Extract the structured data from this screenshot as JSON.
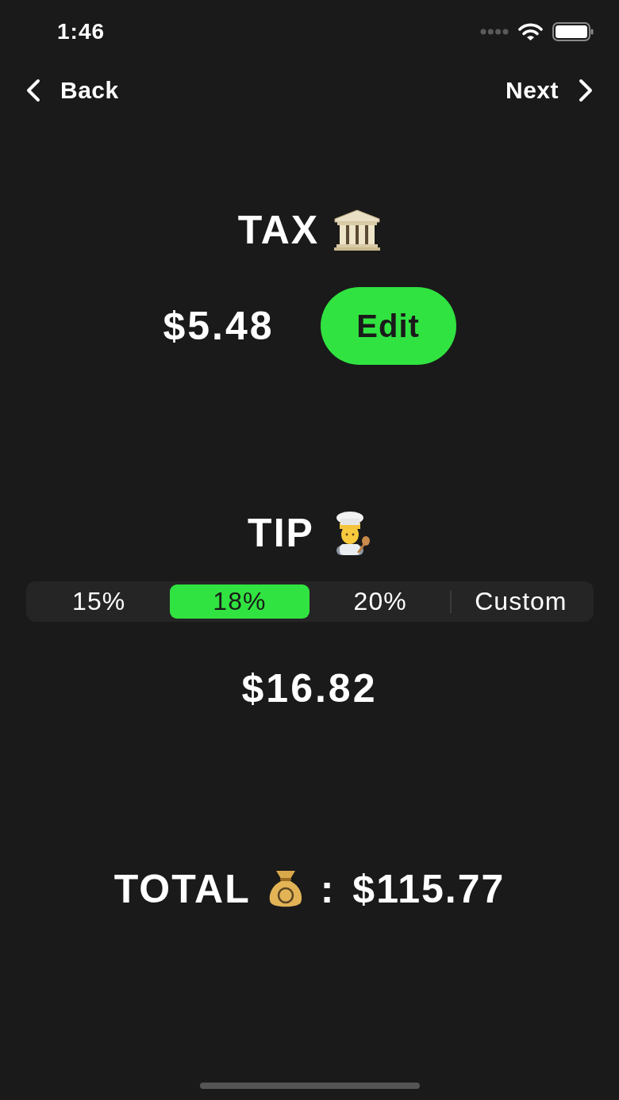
{
  "status_bar": {
    "time": "1:46"
  },
  "nav": {
    "back": "Back",
    "next": "Next"
  },
  "tax": {
    "title": "TAX",
    "amount": "$5.48",
    "edit_button": "Edit"
  },
  "tip": {
    "title": "TIP",
    "options": [
      {
        "label": "15%",
        "selected": false
      },
      {
        "label": "18%",
        "selected": true
      },
      {
        "label": "20%",
        "selected": false
      },
      {
        "label": "Custom",
        "selected": false
      }
    ],
    "amount": "$16.82"
  },
  "total": {
    "label": "TOTAL",
    "separator": ":",
    "amount": "$115.77"
  }
}
